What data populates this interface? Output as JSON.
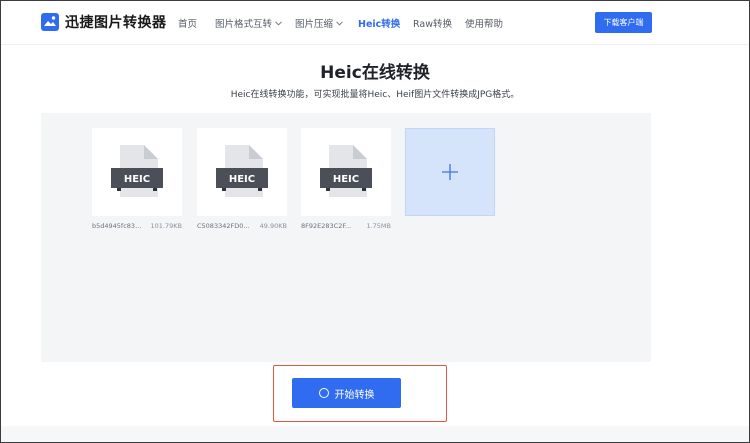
{
  "header": {
    "logo_text": "迅捷图片转换器",
    "nav": [
      {
        "label": "首页",
        "dropdown": false,
        "active": false
      },
      {
        "label": "图片格式互转",
        "dropdown": true,
        "active": false
      },
      {
        "label": "图片压缩",
        "dropdown": true,
        "active": false
      },
      {
        "label": "Heic转换",
        "dropdown": false,
        "active": true
      },
      {
        "label": "Raw转换",
        "dropdown": false,
        "active": false
      },
      {
        "label": "使用帮助",
        "dropdown": false,
        "active": false
      }
    ],
    "download_label": "下载客户端"
  },
  "main": {
    "title": "Heic在线转换",
    "subtitle": "Heic在线转换功能，可实现批量将Heic、Heif图片文件转换成JPG格式。"
  },
  "files": [
    {
      "name": "b5d4945fc83...",
      "size": "101.79KB",
      "badge": "HEIC"
    },
    {
      "name": "C5083342FD0...",
      "size": "49.90KB",
      "badge": "HEIC"
    },
    {
      "name": "8F92E283C2F...",
      "size": "1.75MB",
      "badge": "HEIC"
    }
  ],
  "add_icon": "plus-icon",
  "start_button": {
    "label": "开始转换",
    "icon": "loading-ring-icon"
  },
  "colors": {
    "accent": "#2f6cf0",
    "add_tile": "#d6e4fb",
    "workspace": "#f4f5f7",
    "highlight": "#e0573f"
  }
}
